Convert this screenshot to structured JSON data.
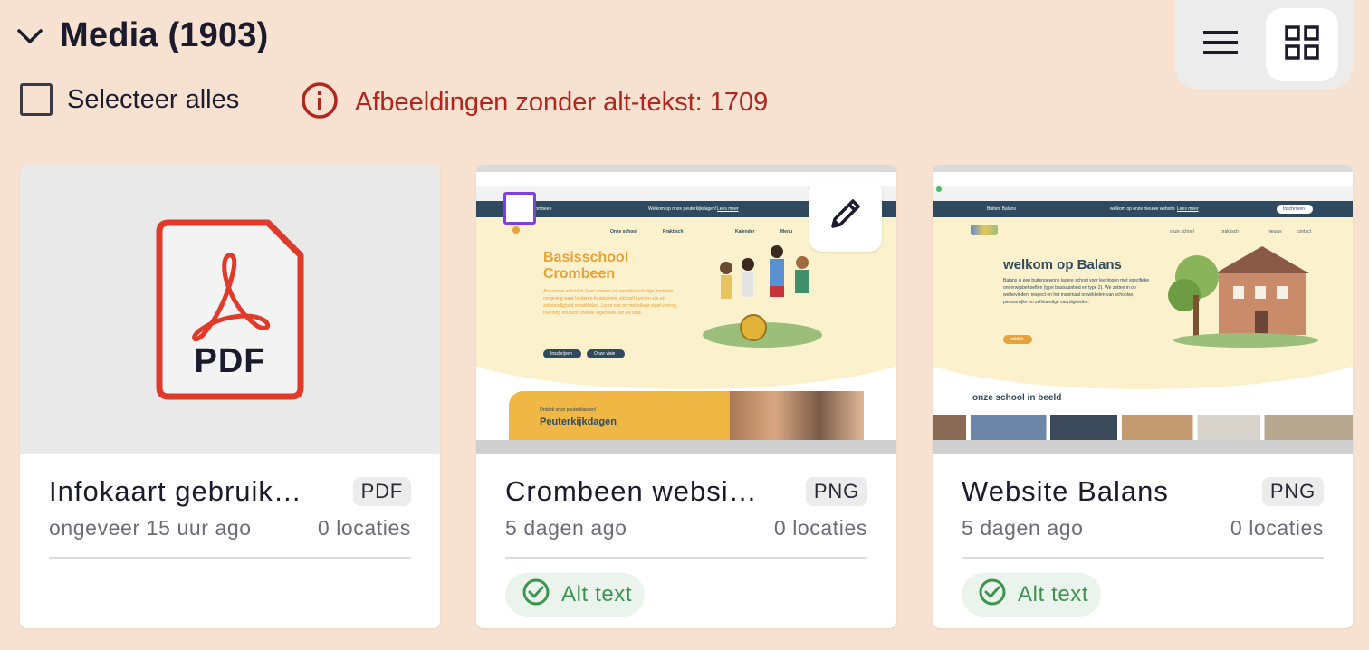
{
  "header": {
    "title": "Media (1903)",
    "collapse_icon": "chevron-down-icon"
  },
  "view_toggle": {
    "list_icon": "list-view-icon",
    "grid_icon": "grid-view-icon",
    "active": "grid"
  },
  "selection": {
    "select_all_label": "Selecteer alles"
  },
  "warning": {
    "icon": "info-icon",
    "text": "Afbeeldingen zonder alt-tekst: 1709",
    "color": "#b3261e"
  },
  "cards": [
    {
      "name": "Infokaart gebruik…",
      "type": "PDF",
      "time": "ongeveer 15 uur ago",
      "locations": "0 locaties",
      "thumb_label": "PDF",
      "alt_text": null
    },
    {
      "name": "Crombeen websi…",
      "type": "PNG",
      "time": "5 dagen ago",
      "locations": "0 locaties",
      "alt_text": "Alt text",
      "thumb": {
        "nav_brand": "Crombeen",
        "welcome": "Welkom op onze peuterkijkdagen!",
        "welcome_link": "Lees meer",
        "menu": [
          "Onze school",
          "Praktisch",
          "Kalender",
          "Menu"
        ],
        "hero_title_1": "Basisschool",
        "hero_title_2": "Crombeen",
        "hero_text": "Als warme school in Gent vormen we een kleinschalige, familiale omgeving waar kinderen thuiskomen, zichzelf kunnen zijn en zelfstandigheid ontwikkelen. Leren van en met elkaar staat voorop, rekening houdend met de eigenheid van elk kind.",
        "btn1": "Inschrijven",
        "btn2": "Onze visie",
        "promo_small": "Ontdek onze peuterklassen!",
        "promo_title": "Peuterkijkdagen"
      }
    },
    {
      "name": "Website Balans",
      "type": "PNG",
      "time": "5 dagen ago",
      "locations": "0 locaties",
      "alt_text": "Alt text",
      "thumb": {
        "nav_brand": "Buitenl Balans",
        "welcome": "welkom op onze nieuwe website",
        "welcome_link": "Lees meer",
        "nav_btn": "Inschrijven",
        "menu": [
          "onze school",
          "praktisch",
          "nieuws",
          "contact"
        ],
        "hero_title": "welkom op Balans",
        "hero_text": "Balans is een buitengewone lagere school voor leerlingen met specifieke onderwijsbehoeften (type basisaanbod en type 2). We zetten in op welbevinden, respect en het maximaal ontwikkelen van schoolse, persoonlijke en zelfstandige vaardigheden.",
        "hero_btn": "ontdek",
        "section_title": "onze school in beeld"
      }
    }
  ],
  "colors": {
    "background": "#f7e1d0",
    "accent_purple": "#7b3fe4",
    "pdf_red": "#e03a2a",
    "alt_green": "#3d9450"
  }
}
